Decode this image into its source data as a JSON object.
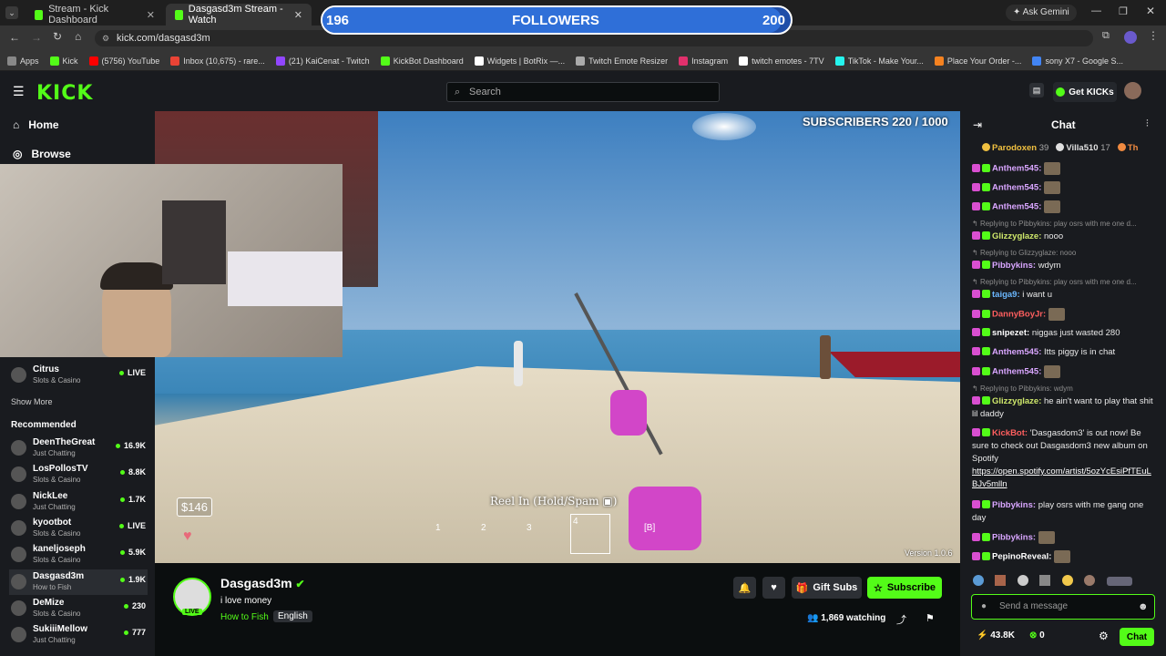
{
  "browser": {
    "tabs": [
      {
        "label": "Stream - Kick Dashboard"
      },
      {
        "label": "Dasgasd3m Stream - Watch"
      }
    ],
    "url": "kick.com/dasgasd3m",
    "ask_gemini": "Ask Gemini",
    "bookmarks": [
      {
        "label": "Apps",
        "color": "#888888"
      },
      {
        "label": "Kick",
        "color": "#53fc18"
      },
      {
        "label": "(5756) YouTube",
        "color": "#ff0000"
      },
      {
        "label": "Inbox (10,675) - rare...",
        "color": "#ea4335"
      },
      {
        "label": "(21) KaiCenat - Twitch",
        "color": "#9146ff"
      },
      {
        "label": "KickBot Dashboard",
        "color": "#53fc18"
      },
      {
        "label": "Widgets | BotRix —...",
        "color": "#ffffff"
      },
      {
        "label": "Twitch Emote Resizer",
        "color": "#aaaaaa"
      },
      {
        "label": "Instagram",
        "color": "#e1306c"
      },
      {
        "label": "twitch emotes - 7TV",
        "color": "#ffffff"
      },
      {
        "label": "TikTok - Make Your...",
        "color": "#25f4ee"
      },
      {
        "label": "Place Your Order -...",
        "color": "#f58220"
      },
      {
        "label": "sony X7 - Google S...",
        "color": "#4285f4"
      }
    ]
  },
  "overlay": {
    "followers_current": "196",
    "followers_label": "FOLLOWERS",
    "followers_goal": "200",
    "followers_progress": 0.98,
    "subscribers": "SUBSCRIBERS 220 / 1000",
    "game_money": "$146",
    "game_hint": "Reel In (Hold/Spam",
    "version": "Version 1.0.6",
    "hotbar": [
      "1",
      "2",
      "3",
      "4",
      "[B]"
    ]
  },
  "header": {
    "logo": "KICK",
    "search_placeholder": "Search",
    "get_kicks": "Get KICKs"
  },
  "sidebar": {
    "nav": [
      {
        "label": "Home"
      },
      {
        "label": "Browse"
      }
    ],
    "following": [
      {
        "name": "Citrus",
        "category": "Slots & Casino",
        "viewers": "LIVE"
      }
    ],
    "show_more": "Show More",
    "recommended_title": "Recommended",
    "recommended": [
      {
        "name": "DeenTheGreat",
        "category": "Just Chatting",
        "viewers": "16.9K"
      },
      {
        "name": "LosPollosTV",
        "category": "Slots & Casino",
        "viewers": "8.8K"
      },
      {
        "name": "NickLee",
        "category": "Just Chatting",
        "viewers": "1.7K"
      },
      {
        "name": "kyootbot",
        "category": "Slots & Casino",
        "viewers": "LIVE"
      },
      {
        "name": "kaneljoseph",
        "category": "Slots & Casino",
        "viewers": "5.9K"
      },
      {
        "name": "Dasgasd3m",
        "category": "How to Fish",
        "viewers": "1.9K"
      },
      {
        "name": "DeMize",
        "category": "Slots & Casino",
        "viewers": "230"
      },
      {
        "name": "SukiiiMellow",
        "category": "Just Chatting",
        "viewers": "777"
      }
    ]
  },
  "stream": {
    "channel": "Dasgasd3m",
    "title": "i love money",
    "category": "How to Fish",
    "language": "English",
    "live": "LIVE",
    "watching": "1,869 watching",
    "gift_subs": "Gift Subs",
    "subscribe": "Subscribe"
  },
  "chat": {
    "title": "Chat",
    "top_gifters": [
      {
        "name": "Parodoxen",
        "count": "39",
        "color": "#f0c040"
      },
      {
        "name": "Villa510",
        "count": "17",
        "color": "#e0e0e0"
      },
      {
        "name": "Th",
        "count": "",
        "color": "#f08a40"
      }
    ],
    "replies": {
      "r1": "Replying to Pibbykins: play osrs with me one d...",
      "r2": "Replying to Glizzyglaze: nooo",
      "r3": "Replying to Pibbykins: play osrs with me one d...",
      "r4": "Replying to Pibbykins: wdym"
    },
    "messages": {
      "m1": {
        "user": "Anthem545:",
        "text": ""
      },
      "m2": {
        "user": "Anthem545:",
        "text": ""
      },
      "m3": {
        "user": "Anthem545:",
        "text": ""
      },
      "m4": {
        "user": "Glizzyglaze:",
        "text": "nooo"
      },
      "m5": {
        "user": "Pibbykins:",
        "text": "wdym"
      },
      "m6": {
        "user": "taiga9:",
        "text": "i want u"
      },
      "m7": {
        "user": "DannyBoyJr:",
        "text": ""
      },
      "m8": {
        "user": "snipezet:",
        "text": "niggas just wasted 280"
      },
      "m9": {
        "user": "Anthem545:",
        "text": "Itts piggy is in chat"
      },
      "m10": {
        "user": "Anthem545:",
        "text": ""
      },
      "m11": {
        "user": "Glizzyglaze:",
        "text": "he ain't want to play that shit lil daddy"
      },
      "m12": {
        "user": "KickBot:",
        "text": "'Dasgasdom3' is out now! Be sure to check out Dasgasdom3 new album on Spotify",
        "link": "https://open.spotify.com/artist/5ozYcEsiPfTEuLBJv5mlln"
      },
      "m13": {
        "user": "Pibbykins:",
        "text": "play osrs with me gang one day"
      },
      "m14": {
        "user": "Pibbykins:",
        "text": ""
      },
      "m15": {
        "user": "PepinoReveal:",
        "text": ""
      }
    },
    "input_placeholder": "Send a message",
    "kicks_balance": "43.8K",
    "points": "0",
    "send_label": "Chat"
  }
}
